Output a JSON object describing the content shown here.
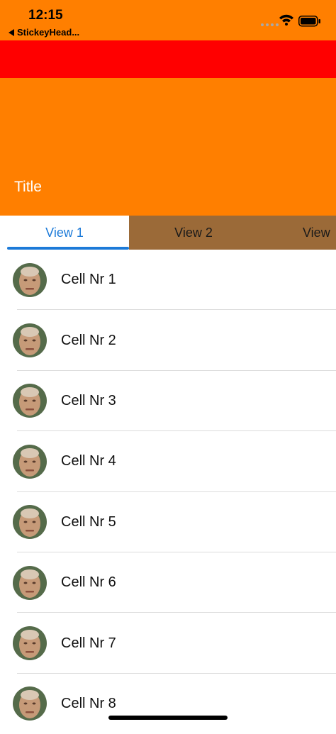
{
  "status_bar": {
    "time": "12:15",
    "back_label": "StickeyHead..."
  },
  "colors": {
    "header": "#ff7f00",
    "band": "#ff0000",
    "tabbar": "#9b6a38",
    "accent": "#1c7ad8"
  },
  "header": {
    "title": "Title"
  },
  "tabs": [
    {
      "label": "View 1",
      "selected": true
    },
    {
      "label": "View 2",
      "selected": false
    },
    {
      "label": "View",
      "selected": false
    }
  ],
  "cells": [
    {
      "label": "Cell Nr 1",
      "icon": "person-avatar-icon"
    },
    {
      "label": "Cell Nr 2",
      "icon": "person-avatar-icon"
    },
    {
      "label": "Cell Nr 3",
      "icon": "person-avatar-icon"
    },
    {
      "label": "Cell Nr 4",
      "icon": "person-avatar-icon"
    },
    {
      "label": "Cell Nr 5",
      "icon": "person-avatar-icon"
    },
    {
      "label": "Cell Nr 6",
      "icon": "person-avatar-icon"
    },
    {
      "label": "Cell Nr 7",
      "icon": "person-avatar-icon"
    },
    {
      "label": "Cell Nr 8",
      "icon": "person-avatar-icon"
    }
  ]
}
